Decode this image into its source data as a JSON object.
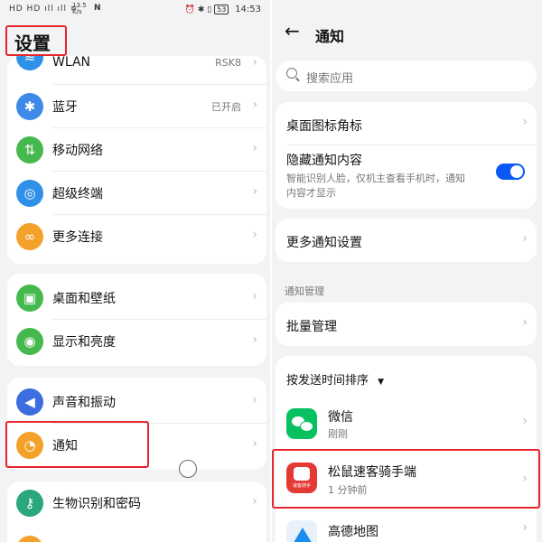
{
  "status_bar": {
    "left_icons": "HD HD ıll ıll ≋",
    "net_speed": "13.5 K/s",
    "right_icons": "⏰ ✱ ▯",
    "battery": "53",
    "time": "14:53"
  },
  "left": {
    "title": "设置",
    "items": [
      {
        "label": "WLAN",
        "value": "RSK8"
      },
      {
        "label": "蓝牙",
        "value": "已开启"
      },
      {
        "label": "移动网络"
      },
      {
        "label": "超级终端"
      },
      {
        "label": "更多连接"
      },
      {
        "label": "桌面和壁纸"
      },
      {
        "label": "显示和亮度"
      },
      {
        "label": "声音和振动"
      },
      {
        "label": "通知"
      },
      {
        "label": "生物识别和密码"
      }
    ]
  },
  "right": {
    "title": "通知",
    "search_placeholder": "搜索应用",
    "badge_label": "桌面图标角标",
    "hide_content_label": "隐藏通知内容",
    "hide_content_desc_1": "智能识别人脸，仅机主查看手机时，通知",
    "hide_content_desc_2": "内容才显示",
    "hide_content_enabled": true,
    "more_settings_label": "更多通知设置",
    "section_label": "通知管理",
    "batch_label": "批量管理",
    "sort_label": "按发送时间排序",
    "apps": [
      {
        "name": "微信",
        "time": "刚刚"
      },
      {
        "name": "松鼠速客骑手端",
        "time": "1 分钟前",
        "icon_text": "速客骑手"
      },
      {
        "name": "高德地图"
      }
    ]
  },
  "colors": {
    "accent": "#0a59f7",
    "highlight_box": "#e8232b",
    "bluetooth": "#3f8ae8",
    "mobile_network": "#46b94e",
    "super_device": "#2f90e8",
    "more_connections": "#f4a12b",
    "desktop": "#46b94e",
    "display": "#46b94e",
    "sound": "#3b6fe0",
    "notification": "#f4a12b",
    "biometrics": "#2aa77b",
    "wechat": "#07c160",
    "songshu": "#e53935"
  }
}
